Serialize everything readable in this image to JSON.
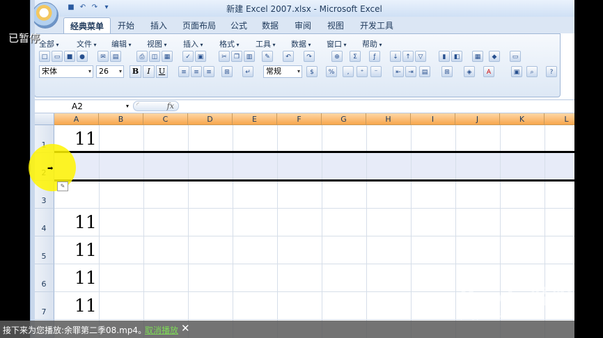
{
  "window": {
    "title": "新建 Excel 2007.xlsx - Microsoft Excel"
  },
  "quick_access": [
    "save-icon",
    "undo-icon",
    "redo-icon",
    "customize-icon"
  ],
  "tabs": [
    {
      "label": "经典菜单",
      "active": true
    },
    {
      "label": "开始"
    },
    {
      "label": "插入"
    },
    {
      "label": "页面布局"
    },
    {
      "label": "公式"
    },
    {
      "label": "数据"
    },
    {
      "label": "审阅"
    },
    {
      "label": "视图"
    },
    {
      "label": "开发工具"
    }
  ],
  "classic_menu": [
    "全部",
    "文件",
    "编辑",
    "视图",
    "插入",
    "格式",
    "工具",
    "数据",
    "窗口",
    "帮助"
  ],
  "toolbar": {
    "font_name": "宋体",
    "font_size": "26",
    "bold_label": "B",
    "italic_label": "I",
    "underline_label": "U",
    "number_format": "常规"
  },
  "formula_bar": {
    "cell_ref": "A2",
    "fx_label": "fx",
    "formula": ""
  },
  "columns": [
    "A",
    "B",
    "C",
    "D",
    "E",
    "F",
    "G",
    "H",
    "I",
    "J",
    "K",
    "L"
  ],
  "rows": [
    {
      "num": "1",
      "a": "11"
    },
    {
      "num": "2",
      "a": ""
    },
    {
      "num": "3",
      "a": ""
    },
    {
      "num": "4",
      "a": "11"
    },
    {
      "num": "5",
      "a": "11"
    },
    {
      "num": "6",
      "a": "11"
    },
    {
      "num": "7",
      "a": "11"
    }
  ],
  "player": {
    "paused_label": "已暂停",
    "next_message": "接下来为您播放:余罪第二季08.mp4。",
    "cancel_link": "取消播放",
    "close_label": "✕"
  },
  "watermark": {
    "brand": "Baidu经验",
    "url": "jingyan.baidu.com"
  },
  "colors": {
    "selected_col_header": "#f7a64d",
    "selected_row": "#e7ebf8",
    "highlight": "#fff400"
  }
}
